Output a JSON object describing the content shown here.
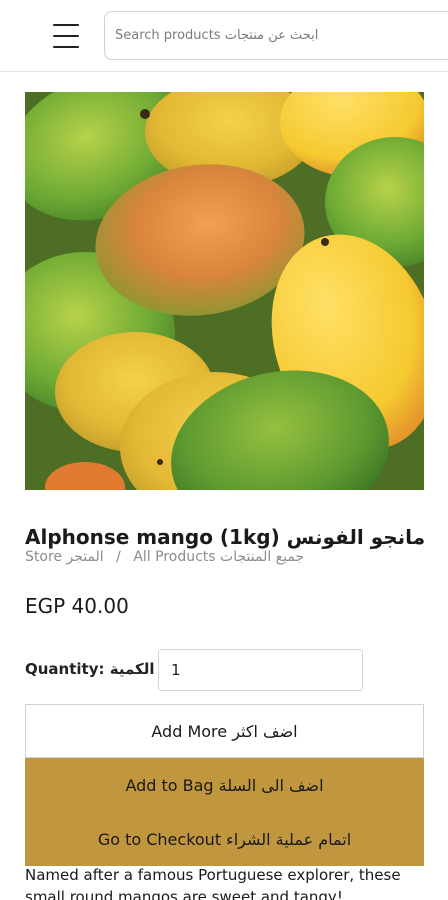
{
  "header": {
    "search_placeholder": "Search products ابحث عن منتجات"
  },
  "product": {
    "title": "Alphonse mango (1kg) مانجو الفونس",
    "breadcrumb": {
      "store": "Store المتجر",
      "separator": "/",
      "all_products": "All Products جميع المنتجات"
    },
    "price": "EGP 40.00",
    "quantity_label": "Quantity: الكمية",
    "quantity_value": "1",
    "description": "Named after a famous Portuguese explorer, these small round mangos are sweet and tangy!"
  },
  "actions": {
    "add_more": "Add More اضف اكثر",
    "add_to_bag": "Add to Bag اضف الى السلة",
    "checkout": "Go to Checkout اتمام عملية الشراء"
  },
  "colors": {
    "accent": "#c0963e"
  },
  "icons": {
    "menu": "hamburger-menu-icon"
  }
}
